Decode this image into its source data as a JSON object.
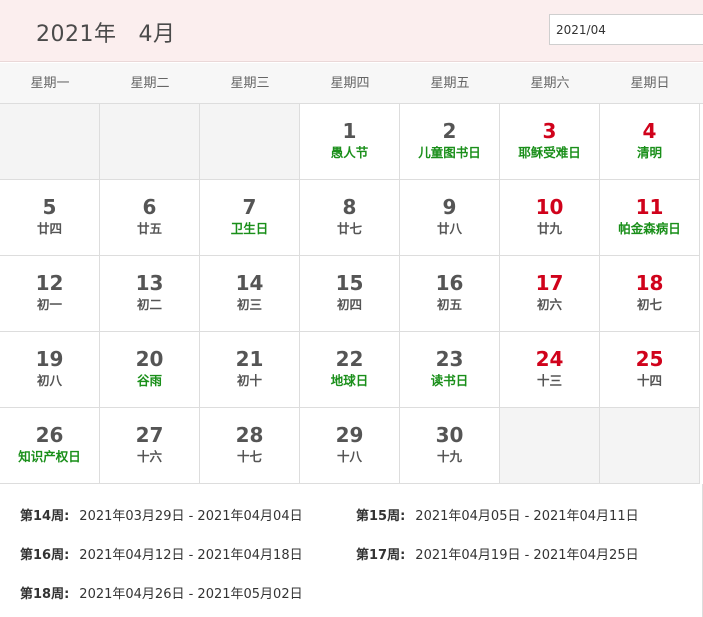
{
  "header": {
    "year": "2021年",
    "month": "4月"
  },
  "date_picker": {
    "value": "2021/04"
  },
  "weekdays": [
    "星期一",
    "星期二",
    "星期三",
    "星期四",
    "星期五",
    "星期六",
    "星期日"
  ],
  "leading_empty": 3,
  "trailing_empty": 2,
  "days": [
    {
      "day": "1",
      "sub": "愚人节",
      "festival": true,
      "weekend": false
    },
    {
      "day": "2",
      "sub": "儿童图书日",
      "festival": true,
      "weekend": false
    },
    {
      "day": "3",
      "sub": "耶稣受难日",
      "festival": true,
      "weekend": true
    },
    {
      "day": "4",
      "sub": "清明",
      "festival": true,
      "weekend": true
    },
    {
      "day": "5",
      "sub": "廿四",
      "festival": false,
      "weekend": false
    },
    {
      "day": "6",
      "sub": "廿五",
      "festival": false,
      "weekend": false
    },
    {
      "day": "7",
      "sub": "卫生日",
      "festival": true,
      "weekend": false
    },
    {
      "day": "8",
      "sub": "廿七",
      "festival": false,
      "weekend": false
    },
    {
      "day": "9",
      "sub": "廿八",
      "festival": false,
      "weekend": false
    },
    {
      "day": "10",
      "sub": "廿九",
      "festival": false,
      "weekend": true
    },
    {
      "day": "11",
      "sub": "帕金森病日",
      "festival": true,
      "weekend": true
    },
    {
      "day": "12",
      "sub": "初一",
      "festival": false,
      "weekend": false
    },
    {
      "day": "13",
      "sub": "初二",
      "festival": false,
      "weekend": false
    },
    {
      "day": "14",
      "sub": "初三",
      "festival": false,
      "weekend": false
    },
    {
      "day": "15",
      "sub": "初四",
      "festival": false,
      "weekend": false
    },
    {
      "day": "16",
      "sub": "初五",
      "festival": false,
      "weekend": false
    },
    {
      "day": "17",
      "sub": "初六",
      "festival": false,
      "weekend": true
    },
    {
      "day": "18",
      "sub": "初七",
      "festival": false,
      "weekend": true
    },
    {
      "day": "19",
      "sub": "初八",
      "festival": false,
      "weekend": false
    },
    {
      "day": "20",
      "sub": "谷雨",
      "festival": true,
      "weekend": false
    },
    {
      "day": "21",
      "sub": "初十",
      "festival": false,
      "weekend": false
    },
    {
      "day": "22",
      "sub": "地球日",
      "festival": true,
      "weekend": false
    },
    {
      "day": "23",
      "sub": "读书日",
      "festival": true,
      "weekend": false
    },
    {
      "day": "24",
      "sub": "十三",
      "festival": false,
      "weekend": true
    },
    {
      "day": "25",
      "sub": "十四",
      "festival": false,
      "weekend": true
    },
    {
      "day": "26",
      "sub": "知识产权日",
      "festival": true,
      "weekend": false
    },
    {
      "day": "27",
      "sub": "十六",
      "festival": false,
      "weekend": false
    },
    {
      "day": "28",
      "sub": "十七",
      "festival": false,
      "weekend": false
    },
    {
      "day": "29",
      "sub": "十八",
      "festival": false,
      "weekend": false
    },
    {
      "day": "30",
      "sub": "十九",
      "festival": false,
      "weekend": false
    }
  ],
  "week_ranges": [
    {
      "label": "第14周:",
      "range": "2021年03月29日 - 2021年04月04日"
    },
    {
      "label": "第15周:",
      "range": "2021年04月05日 - 2021年04月11日"
    },
    {
      "label": "第16周:",
      "range": "2021年04月12日 - 2021年04月18日"
    },
    {
      "label": "第17周:",
      "range": "2021年04月19日 - 2021年04月25日"
    },
    {
      "label": "第18周:",
      "range": "2021年04月26日 - 2021年05月02日"
    }
  ],
  "colors": {
    "weekend": "#d0021b",
    "festival": "#1a8f1a",
    "header_bg": "#fbeeee"
  }
}
